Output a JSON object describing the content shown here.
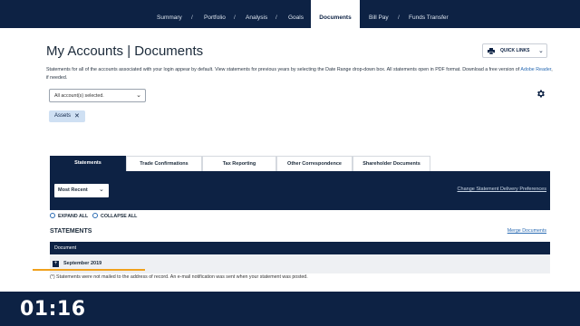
{
  "nav": {
    "items": [
      "Summary",
      "Portfolio",
      "Analysis",
      "Goals",
      "Documents",
      "Bill Pay",
      "Funds Transfer"
    ],
    "active": "Documents",
    "separator": "/"
  },
  "page": {
    "title": "My Accounts | Documents",
    "quick_links_label": "QUICK LINKS",
    "description_pre": "Statements for all of the accounts associated with your login appear by default. View statements for previous years by selecting the Date Range drop-down box. All statements open in PDF format. Download a free version of ",
    "description_link": "Adobe Reader",
    "description_post": ", if needed."
  },
  "filters": {
    "account_select_value": "All account(s) selected.",
    "chip_label": "Assets",
    "chip_remove": "✕"
  },
  "tabs": [
    {
      "label": "Statements",
      "active": true
    },
    {
      "label": "Trade Confirmations",
      "active": false
    },
    {
      "label": "Tax Reporting",
      "active": false
    },
    {
      "label": "Other Correspondence",
      "active": false
    },
    {
      "label": "Shareholder Documents",
      "active": false
    }
  ],
  "panel": {
    "date_range_value": "Most Recent",
    "delivery_link": "Change Statement Delivery Preferences"
  },
  "controls": {
    "expand_all": "EXPAND ALL",
    "collapse_all": "COLLAPSE ALL"
  },
  "statements": {
    "title": "STATEMENTS",
    "merge_link": "Merge Documents",
    "column_header": "Document",
    "rows": [
      {
        "label": "September 2019"
      }
    ],
    "footnote": "(*) Statements were not mailed to the address of record. An e-mail notification was sent when your statement was posted."
  },
  "video": {
    "timestamp": "01:16"
  },
  "colors": {
    "navy": "#0d2244",
    "link": "#2a6bb3",
    "chip": "#cfe0f3",
    "highlight": "#f0a11c"
  }
}
